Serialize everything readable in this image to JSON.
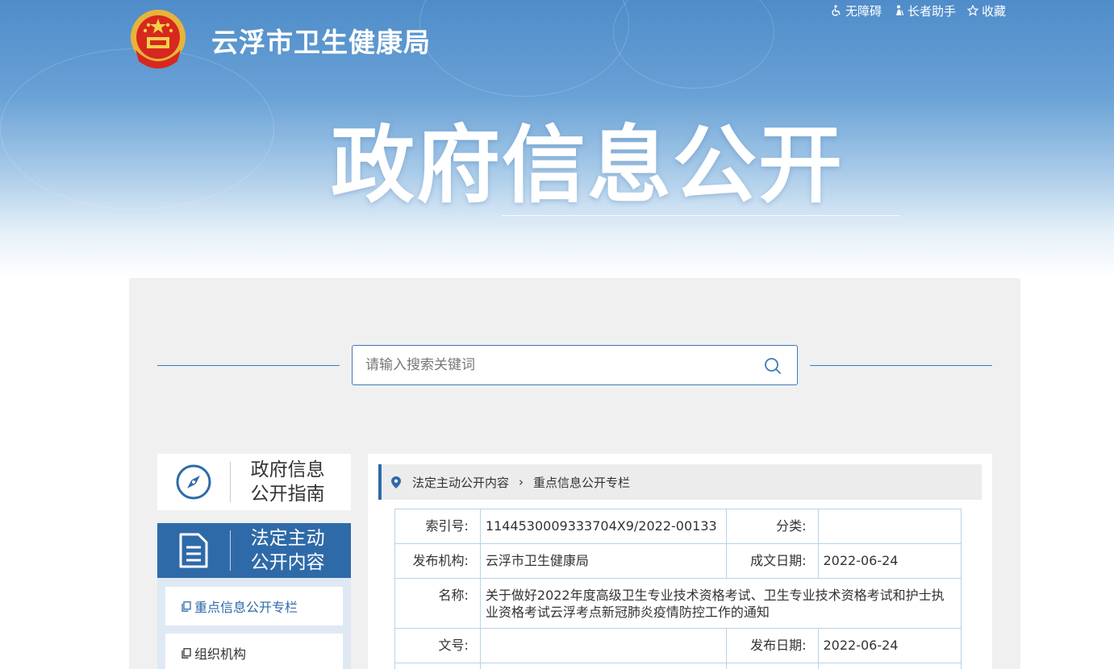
{
  "header": {
    "site_title": "云浮市卫生健康局",
    "big_title": "政府信息公开",
    "top_links": [
      {
        "label": "无障碍",
        "icon": "accessibility-icon"
      },
      {
        "label": "长者助手",
        "icon": "elderly-helper-icon"
      },
      {
        "label": "收藏",
        "icon": "star-icon"
      }
    ]
  },
  "search": {
    "placeholder": "请输入搜索关键词",
    "value": ""
  },
  "sidebar": {
    "guide_label": [
      "政府信息",
      "公开指南"
    ],
    "active_label": [
      "法定主动",
      "公开内容"
    ],
    "items": [
      {
        "label": "重点信息公开专栏",
        "selected": true
      },
      {
        "label": "组织机构",
        "selected": false
      }
    ]
  },
  "breadcrumb": {
    "items": [
      "法定主动公开内容",
      "重点信息公开专栏"
    ]
  },
  "info": {
    "index_label": "索引号:",
    "index_value": "1144530009333704X9/2022-00133",
    "category_label": "分类:",
    "category_value": "",
    "publisher_label": "发布机构:",
    "publisher_value": "云浮市卫生健康局",
    "created_label": "成文日期:",
    "created_value": "2022-06-24",
    "name_label": "名称:",
    "name_value": "关于做好2022年度高级卫生专业技术资格考试、卫生专业技术资格考试和护士执业资格考试云浮考点新冠肺炎疫情防控工作的通知",
    "docno_label": "文号:",
    "docno_value": "",
    "published_label": "发布日期:",
    "published_value": "2022-06-24"
  },
  "colors": {
    "brand_blue": "#2f6aa8",
    "search_border": "#3c7bbd",
    "table_border": "#b8d3e6",
    "panel_bg": "#f0f0f0"
  }
}
